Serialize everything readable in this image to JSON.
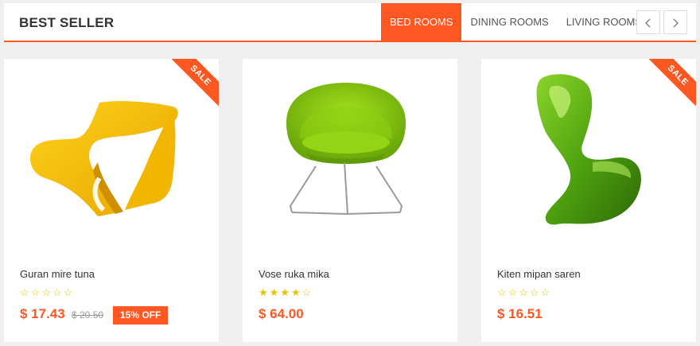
{
  "header": {
    "title": "BEST SELLER",
    "tabs": [
      {
        "label": "BED ROOMS",
        "active": true
      },
      {
        "label": "DINING ROOMS",
        "active": false
      },
      {
        "label": "LIVING ROOMS",
        "active": false
      }
    ],
    "prev_icon": "chevron-left-icon",
    "next_icon": "chevron-right-icon"
  },
  "colors": {
    "accent": "#ff5722",
    "star": "#e6c300",
    "text": "#333333"
  },
  "products": [
    {
      "name": "Guran mire tuna",
      "rating": 0,
      "max_rating": 5,
      "price": "$ 17.43",
      "old_price": "$ 20.50",
      "discount": "15% OFF",
      "badge": "SALE",
      "image": "yellow-chair"
    },
    {
      "name": "Vose ruka mika",
      "rating": 4,
      "max_rating": 5,
      "price": "$ 64.00",
      "image": "green-armchair"
    },
    {
      "name": "Kiten mipan saren",
      "rating": 0,
      "max_rating": 5,
      "price": "$ 16.51",
      "badge": "SALE",
      "image": "green-panton-chair"
    }
  ]
}
